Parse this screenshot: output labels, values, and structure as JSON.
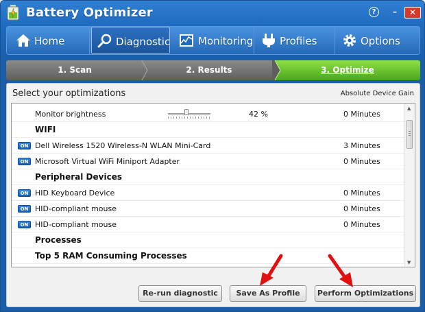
{
  "window": {
    "title": "Battery Optimizer",
    "help_glyph": "?",
    "minimize_glyph": "–",
    "close_glyph": "✕"
  },
  "nav": {
    "tabs": [
      {
        "label": "Home",
        "icon": "home-icon",
        "active": false
      },
      {
        "label": "Diagnostic",
        "icon": "magnifier-icon",
        "active": true
      },
      {
        "label": "Monitoring",
        "icon": "chart-icon",
        "active": false
      },
      {
        "label": "Profiles",
        "icon": "plug-icon",
        "active": false
      },
      {
        "label": "Options",
        "icon": "gear-icon",
        "active": false
      }
    ]
  },
  "steps": [
    {
      "label": "1. Scan",
      "state": "done"
    },
    {
      "label": "2. Results",
      "state": "done"
    },
    {
      "label": "3. Optimize",
      "state": "current"
    }
  ],
  "panel": {
    "title": "Select your optimizations",
    "gain_header": "Absolute Device Gain",
    "on_label": "ON",
    "rows": [
      {
        "kind": "item",
        "name": "Monitor brightness",
        "slider_value": 0.42,
        "value": "42 %",
        "gain": "0 Minutes"
      },
      {
        "kind": "header",
        "name": "WIFI"
      },
      {
        "kind": "item",
        "name": "Dell Wireless 1520 Wireless-N WLAN Mini-Card",
        "toggle": "ON",
        "gain": "3 Minutes"
      },
      {
        "kind": "item",
        "name": "Microsoft Virtual WiFi Miniport Adapter",
        "toggle": "ON",
        "gain": "0 Minutes"
      },
      {
        "kind": "header",
        "name": "Peripheral Devices"
      },
      {
        "kind": "item",
        "name": "HID Keyboard Device",
        "toggle": "ON",
        "gain": "0 Minutes"
      },
      {
        "kind": "item",
        "name": "HID-compliant mouse",
        "toggle": "ON",
        "gain": "0 Minutes"
      },
      {
        "kind": "item",
        "name": "HID-compliant mouse",
        "toggle": "ON",
        "gain": "0 Minutes"
      },
      {
        "kind": "header",
        "name": "Processes"
      },
      {
        "kind": "header",
        "name": "Top 5 RAM Consuming Processes"
      }
    ]
  },
  "buttons": {
    "rerun": "Re-run diagnostic",
    "save": "Save As Profile",
    "perform": "Perform Optimizations"
  },
  "colors": {
    "window_blue": "#1f6bc0",
    "step_current": "#6cc330",
    "step_done": "#707070",
    "annotation_arrow": "#e01010"
  }
}
